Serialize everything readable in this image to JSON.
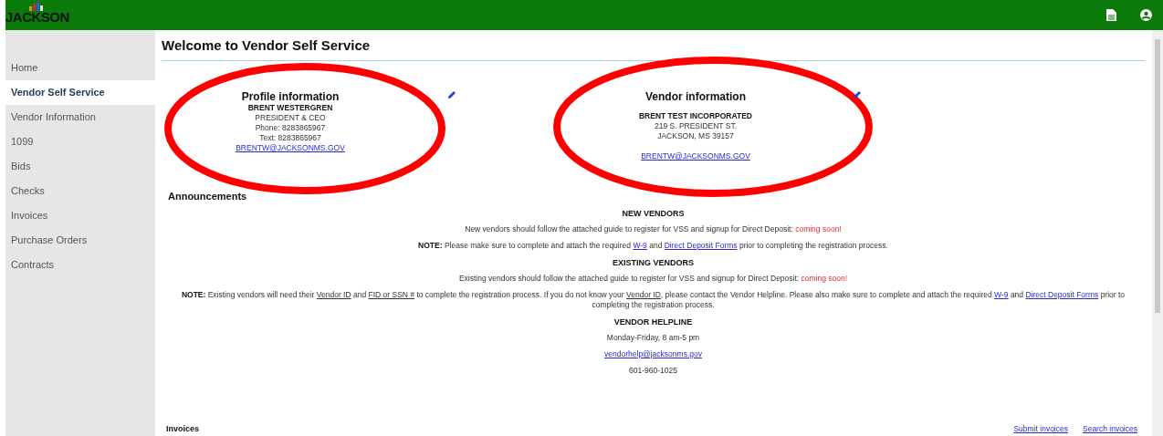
{
  "header": {
    "logo": "JACKSON"
  },
  "sidebar": {
    "items": [
      {
        "label": "Home",
        "selected": false
      },
      {
        "label": "Vendor Self Service",
        "selected": true
      },
      {
        "label": "Vendor Information",
        "selected": false
      },
      {
        "label": "1099",
        "selected": false
      },
      {
        "label": "Bids",
        "selected": false
      },
      {
        "label": "Checks",
        "selected": false
      },
      {
        "label": "Invoices",
        "selected": false
      },
      {
        "label": "Purchase Orders",
        "selected": false
      },
      {
        "label": "Contracts",
        "selected": false
      }
    ]
  },
  "page_title": "Welcome to Vendor Self Service",
  "profile": {
    "title": "Profile information",
    "name": "BRENT WESTERGREN",
    "lines": [
      "PRESIDENT & CEO",
      "Phone: 8283865967",
      "Text: 8283865967"
    ],
    "email": "BRENTW@JACKSONMS.GOV"
  },
  "vendor": {
    "title": "Vendor information",
    "name": "BRENT TEST INCORPORATED",
    "lines": [
      "219 S. PRESIDENT ST.",
      "JACKSON, MS 39157"
    ],
    "email": "BRENTW@JACKSONMS.GOV"
  },
  "announcements": {
    "title": "Announcements",
    "blocks": [
      {
        "kind": "heading",
        "parts": [
          {
            "kind": "text",
            "text": "NEW VENDORS"
          }
        ]
      },
      {
        "kind": "para",
        "parts": [
          {
            "kind": "text",
            "text": "New vendors should follow the attached guide to register for VSS and signup for Direct Deposit: "
          },
          {
            "kind": "alert",
            "text": "coming soon!"
          }
        ]
      },
      {
        "kind": "para",
        "parts": [
          {
            "kind": "bold",
            "text": "NOTE:"
          },
          {
            "kind": "text",
            "text": " Please make sure to complete and attach the required "
          },
          {
            "kind": "link",
            "text": "W-9"
          },
          {
            "kind": "text",
            "text": " and "
          },
          {
            "kind": "link",
            "text": "Direct Deposit Forms"
          },
          {
            "kind": "text",
            "text": " prior to completing the registration process."
          }
        ]
      },
      {
        "kind": "heading",
        "parts": [
          {
            "kind": "text",
            "text": "EXISTING VENDORS"
          }
        ]
      },
      {
        "kind": "para",
        "parts": [
          {
            "kind": "text",
            "text": "Existing vendors should follow the attached guide to register for VSS and signup for Direct Deposit: "
          },
          {
            "kind": "alert",
            "text": "coming soon!"
          }
        ]
      },
      {
        "kind": "para",
        "parts": [
          {
            "kind": "bold",
            "text": "NOTE:"
          },
          {
            "kind": "text",
            "text": " Existing vendors will need their "
          },
          {
            "kind": "term",
            "text": "Vendor ID"
          },
          {
            "kind": "text",
            "text": " and "
          },
          {
            "kind": "term",
            "text": "FID or SSN #"
          },
          {
            "kind": "text",
            "text": " to complete the registration process. If you do not know your "
          },
          {
            "kind": "term",
            "text": "Vendor ID"
          },
          {
            "kind": "text",
            "text": ", please contact the Vendor Helpline. Please also make sure to complete and attach the required "
          },
          {
            "kind": "link",
            "text": "W-9"
          },
          {
            "kind": "text",
            "text": " and "
          },
          {
            "kind": "link",
            "text": "Direct Deposit Forms"
          },
          {
            "kind": "text",
            "text": " prior to completing the registration process."
          }
        ]
      },
      {
        "kind": "heading",
        "parts": [
          {
            "kind": "text",
            "text": "VENDOR HELPLINE"
          }
        ]
      },
      {
        "kind": "para",
        "parts": [
          {
            "kind": "text",
            "text": "Monday-Friday, 8 am-5 pm"
          }
        ]
      },
      {
        "kind": "para",
        "parts": [
          {
            "kind": "link",
            "text": "vendorhelp@jacksonms.gov"
          }
        ]
      },
      {
        "kind": "para",
        "parts": [
          {
            "kind": "text",
            "text": "601-960-1025"
          }
        ]
      }
    ]
  },
  "invoices": {
    "title": "Invoices",
    "links": [
      "Submit invoices",
      "Search invoices"
    ]
  }
}
